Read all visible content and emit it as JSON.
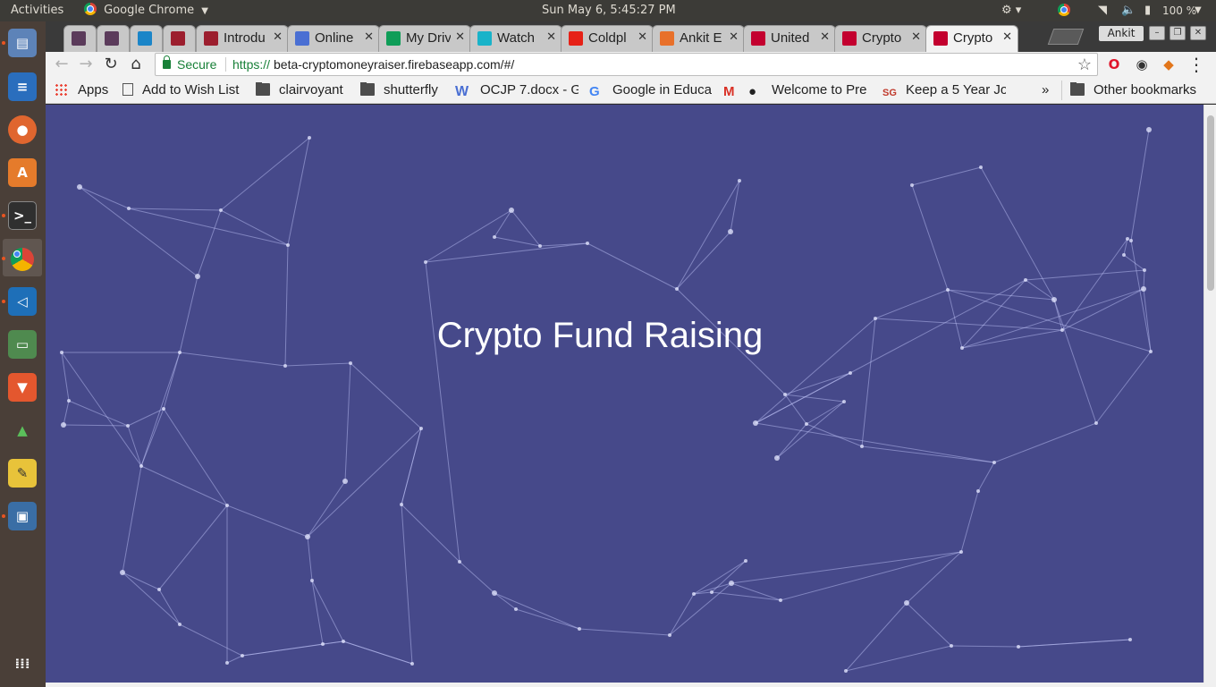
{
  "top_panel": {
    "activities": "Activities",
    "app_name": "Google Chrome",
    "clock": "Sun May  6,  5:45:27 PM",
    "battery": "100 %"
  },
  "launcher": {
    "items": [
      "files-icon",
      "writer-icon",
      "firefox-icon",
      "software-center-icon",
      "terminal-icon",
      "chrome-icon",
      "vscode-icon",
      "notes-icon",
      "brave-icon",
      "robo-icon",
      "text-editor-icon",
      "remote-desktop-icon",
      "app-grid-icon"
    ]
  },
  "tabs": [
    {
      "label": "#",
      "favicon": "#",
      "color": "#5b3b5b"
    },
    {
      "label": "#",
      "favicon": "#",
      "color": "#5b3b5b"
    },
    {
      "label": "",
      "favicon": "shield",
      "color": "#1b85c8"
    },
    {
      "label": "DR",
      "favicon": "DR",
      "color": "#9c1e2e"
    },
    {
      "label": "Introdu",
      "favicon": "DR",
      "color": "#9c1e2e"
    },
    {
      "label": "Online",
      "favicon": "doc",
      "color": "#4a6fd3"
    },
    {
      "label": "My Driv",
      "favicon": "drive",
      "color": "#0f9d58"
    },
    {
      "label": "Watch",
      "favicon": "play",
      "color": "#19b3c9"
    },
    {
      "label": "Coldpl",
      "favicon": "yt",
      "color": "#e62117"
    },
    {
      "label": "Ankit E",
      "favicon": "A",
      "color": "#e8702a"
    },
    {
      "label": "United",
      "favicon": "ng",
      "color": "#c3002f"
    },
    {
      "label": "Crypto",
      "favicon": "ng",
      "color": "#c3002f"
    },
    {
      "label": "Crypto",
      "favicon": "ng",
      "color": "#c3002f"
    }
  ],
  "window": {
    "profile": "Ankit"
  },
  "toolbar": {
    "secure": "Secure",
    "url_scheme": "https://",
    "url_rest": "beta-cryptomoneyraiser.firebaseapp.com/#/"
  },
  "bookmarks": {
    "items": [
      "Apps",
      "Add to Wish List",
      "clairvoyant",
      "shutterfly",
      "OCJP 7.docx - Go",
      "Google in Educa",
      "",
      "Welcome to Pre",
      "Keep a 5 Year Jo"
    ],
    "overflow": "»",
    "other": "Other bookmarks"
  },
  "page": {
    "title": "Crypto Fund Raising",
    "background": "#46498a"
  }
}
